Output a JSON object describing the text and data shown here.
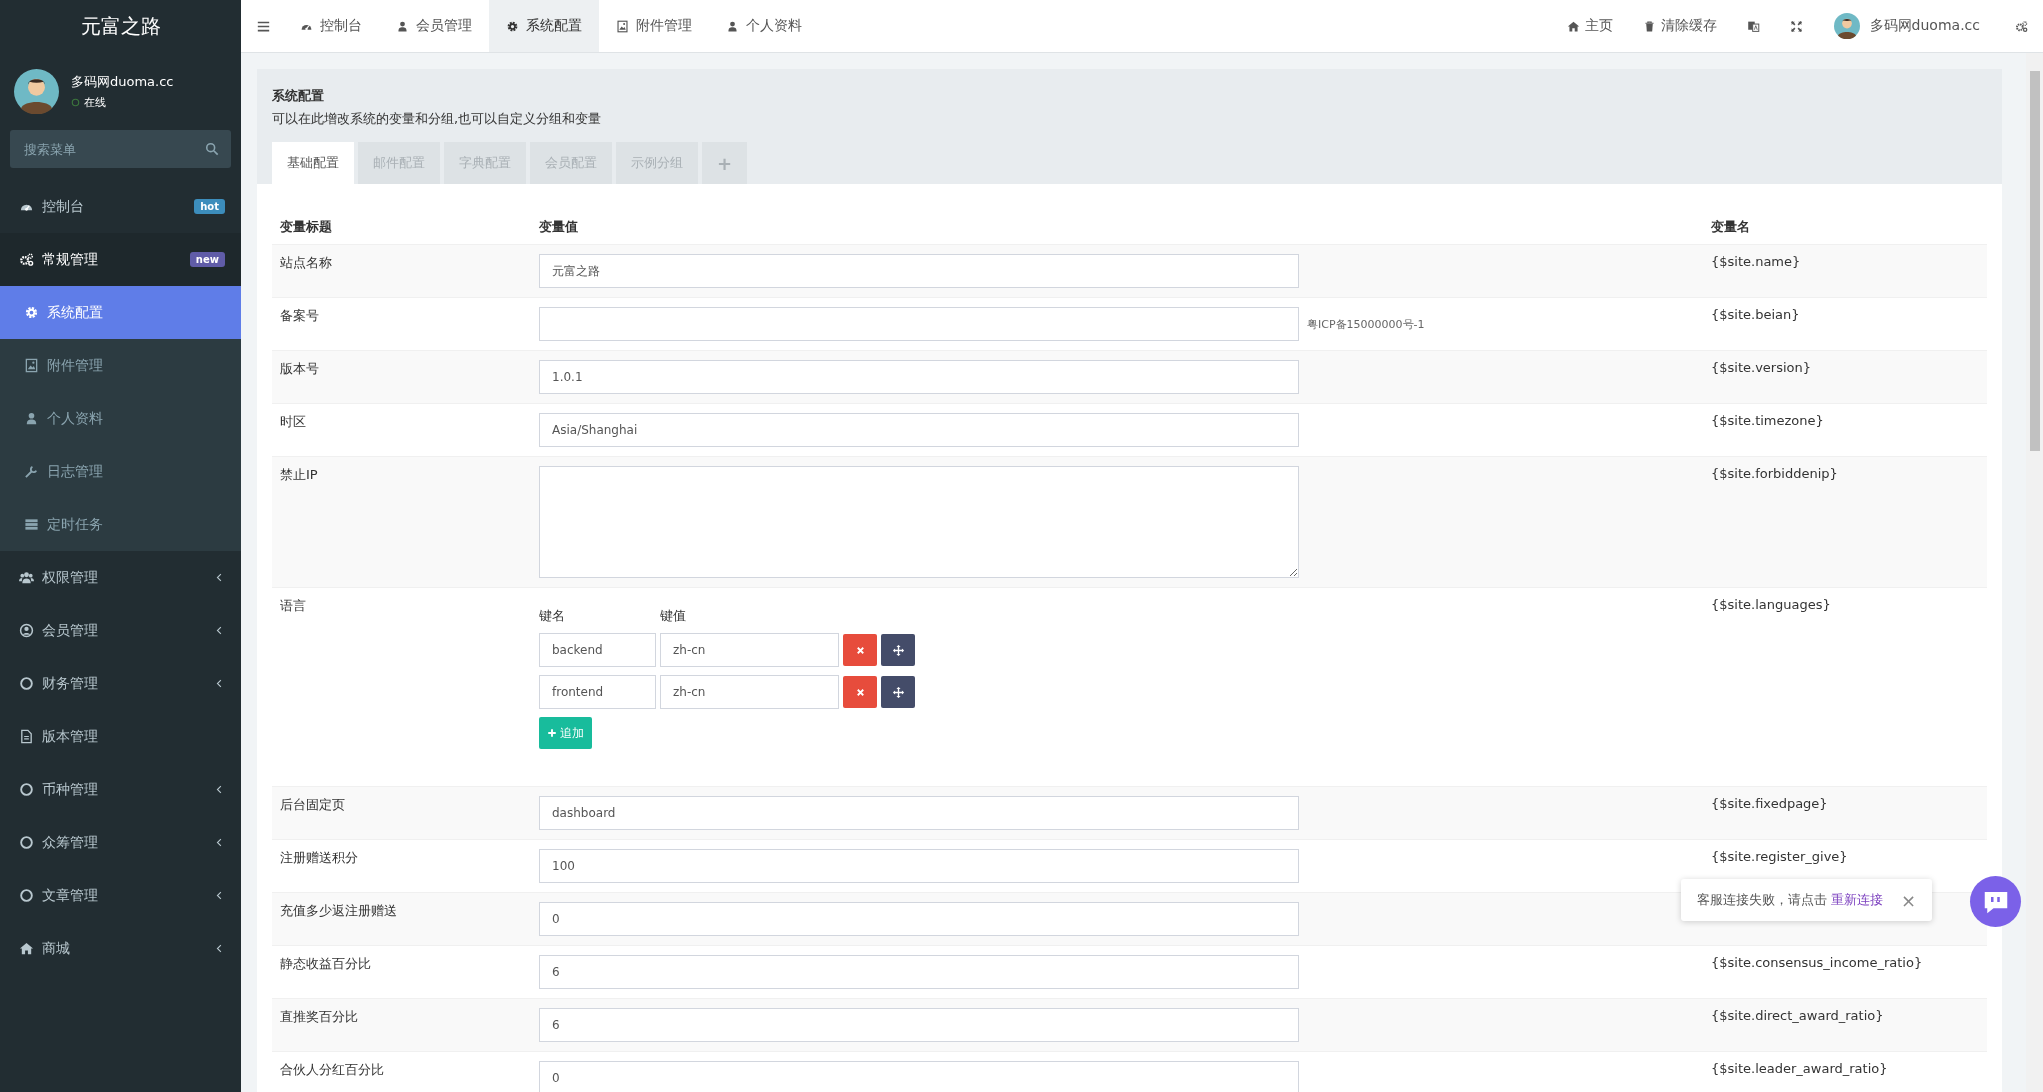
{
  "sidebar": {
    "logo": "元富之路",
    "user": {
      "name": "多码网duoma.cc",
      "status": "在线"
    },
    "search": {
      "placeholder": "搜索菜单"
    },
    "menu": [
      {
        "label": "控制台",
        "badge": {
          "text": "hot",
          "color": "#3c8dbc"
        },
        "selected": false
      },
      {
        "label": "常规管理",
        "badge": {
          "text": "new",
          "color": "#605ca8"
        },
        "expanded": true,
        "selected": false,
        "children": [
          {
            "label": "系统配置",
            "selected": true
          },
          {
            "label": "附件管理",
            "selected": false
          },
          {
            "label": "个人资料",
            "selected": false
          },
          {
            "label": "日志管理",
            "selected": false
          },
          {
            "label": "定时任务",
            "selected": false
          }
        ]
      },
      {
        "label": "权限管理",
        "expanded": false,
        "selected": false
      },
      {
        "label": "会员管理",
        "expanded": false,
        "selected": false
      },
      {
        "label": "财务管理",
        "expanded": false,
        "selected": false
      },
      {
        "label": "版本管理",
        "selected": false
      },
      {
        "label": "币种管理",
        "expanded": false,
        "selected": false
      },
      {
        "label": "众筹管理",
        "expanded": false,
        "selected": false
      },
      {
        "label": "文章管理",
        "expanded": false,
        "selected": false
      },
      {
        "label": "商城",
        "expanded": false,
        "selected": false
      }
    ]
  },
  "topbar": {
    "nav": [
      {
        "label": "控制台",
        "selected": false
      },
      {
        "label": "会员管理",
        "selected": false
      },
      {
        "label": "系统配置",
        "selected": true
      },
      {
        "label": "附件管理",
        "selected": false
      },
      {
        "label": "个人资料",
        "selected": false
      }
    ],
    "links": [
      {
        "label": "主页"
      },
      {
        "label": "清除缓存"
      }
    ],
    "user_name": "多码网duoma.cc"
  },
  "panel": {
    "title": "系统配置",
    "subtitle": "可以在此增改系统的变量和分组,也可以自定义分组和变量",
    "tabs": [
      {
        "label": "基础配置",
        "selected": true
      },
      {
        "label": "邮件配置",
        "selected": false
      },
      {
        "label": "字典配置",
        "selected": false
      },
      {
        "label": "会员配置",
        "selected": false
      },
      {
        "label": "示例分组",
        "selected": false
      }
    ],
    "add_tab": "+",
    "columns": [
      "变量标题",
      "变量值",
      "变量名"
    ],
    "rows": [
      {
        "kind": "input",
        "title": "站点名称",
        "value": "元富之路",
        "var": "{$site.name}"
      },
      {
        "kind": "input",
        "title": "备案号",
        "tip": "粤ICP备15000000号-1",
        "var": "{$site.beian}"
      },
      {
        "kind": "input",
        "title": "版本号",
        "value": "1.0.1",
        "var": "{$site.version}"
      },
      {
        "kind": "input",
        "title": "时区",
        "value": "Asia/Shanghai",
        "var": "{$site.timezone}"
      },
      {
        "kind": "textarea",
        "title": "禁止IP",
        "var": "{$site.forbiddenip}"
      },
      {
        "kind": "array",
        "title": "语言",
        "key_header": "键名",
        "value_header": "键值",
        "pairs": [
          {
            "key": "backend",
            "value": "zh-cn"
          },
          {
            "key": "frontend",
            "value": "zh-cn"
          }
        ],
        "add_label": "追加",
        "var": "{$site.languages}"
      },
      {
        "kind": "input",
        "title": "后台固定页",
        "value": "dashboard",
        "var": "{$site.fixedpage}"
      },
      {
        "kind": "input",
        "title": "注册赠送积分",
        "value": "100",
        "var": "{$site.register_give}"
      },
      {
        "kind": "input",
        "title": "充值多少返注册赠送",
        "value": "0"
      },
      {
        "kind": "input",
        "title": "静态收益百分比",
        "value": "6",
        "var": "{$site.consensus_income_ratio}"
      },
      {
        "kind": "input",
        "title": "直推奖百分比",
        "value": "6",
        "var": "{$site.direct_award_ratio}"
      },
      {
        "kind": "input",
        "title": "合伙人分红百分比",
        "value": "0",
        "var": "{$site.leader_award_ratio}"
      }
    ]
  },
  "toast": {
    "message": "客服连接失败，请点击",
    "link": "重新连接",
    "close": "×"
  }
}
